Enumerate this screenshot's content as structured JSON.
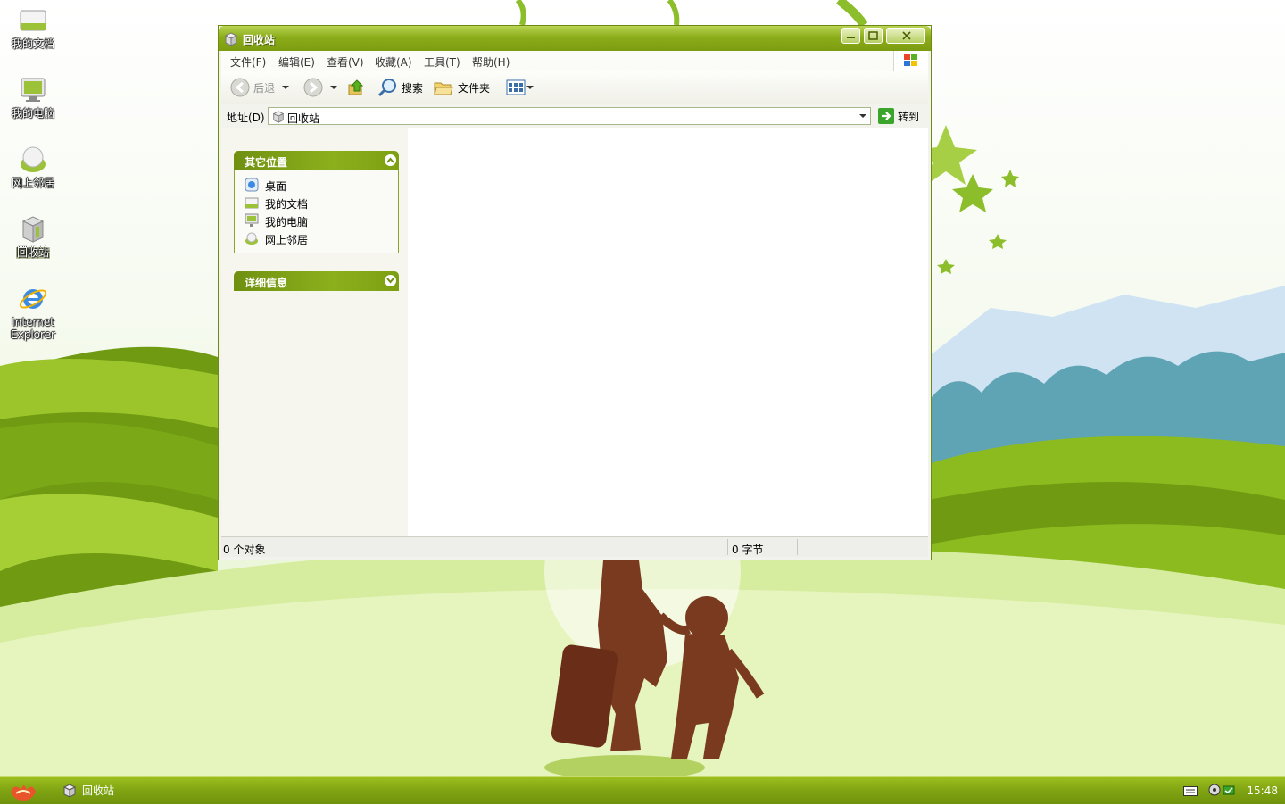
{
  "desktop": {
    "icons": [
      {
        "label": "我的文档",
        "icon": "documents-icon"
      },
      {
        "label": "我的电脑",
        "icon": "computer-icon"
      },
      {
        "label": "网上邻居",
        "icon": "network-icon"
      },
      {
        "label": "回收站",
        "icon": "recycle-bin-icon"
      },
      {
        "label_line1": "Internet",
        "label_line2": "Explorer",
        "icon": "ie-icon"
      }
    ]
  },
  "window": {
    "title": "回收站",
    "menu": [
      "文件(F)",
      "编辑(E)",
      "查看(V)",
      "收藏(A)",
      "工具(T)",
      "帮助(H)"
    ],
    "toolbar": {
      "back_label": "后退",
      "search_label": "搜索",
      "folders_label": "文件夹"
    },
    "address": {
      "label": "地址(D)",
      "value": "回收站",
      "go_label": "转到"
    },
    "taskpane": {
      "other_places": {
        "title": "其它位置",
        "items": [
          {
            "label": "桌面",
            "icon": "desktop-icon"
          },
          {
            "label": "我的文档",
            "icon": "documents-icon"
          },
          {
            "label": "我的电脑",
            "icon": "computer-icon"
          },
          {
            "label": "网上邻居",
            "icon": "network-icon"
          }
        ]
      },
      "details": {
        "title": "详细信息"
      }
    },
    "status": {
      "objects": "0 个对象",
      "size": "0 字节"
    }
  },
  "taskbar": {
    "task_label": "回收站",
    "clock": "15:48"
  },
  "colors": {
    "accent": "#8cad1a",
    "titlebar_dark": "#7c9c10",
    "taskbar": "#7fa312"
  }
}
